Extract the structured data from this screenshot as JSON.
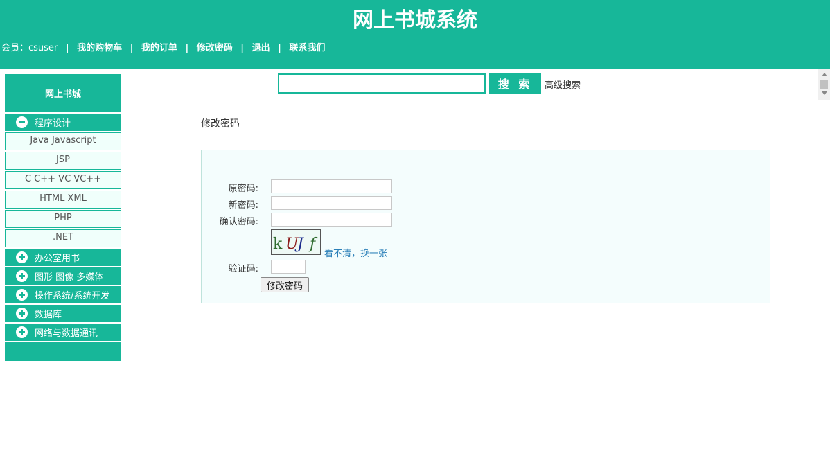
{
  "header": {
    "title": "网上书城系统",
    "member_label": "会员：csuser",
    "nav": [
      "我的购物车",
      "我的订单",
      "修改密码",
      "退出",
      "联系我们"
    ],
    "sep": "|"
  },
  "sidebar": {
    "title": "网上书城",
    "expanded_category": "程序设计",
    "subitems": [
      "Java Javascript",
      "JSP",
      "C C++ VC VC++",
      "HTML XML",
      "PHP",
      ".NET"
    ],
    "categories": [
      "办公室用书",
      "图形 图像 多媒体",
      "操作系统/系统开发",
      "数据库",
      "网络与数据通讯"
    ]
  },
  "search": {
    "placeholder": "",
    "button_label": "搜 索",
    "advanced_link": "高级搜索"
  },
  "main": {
    "page_title": "修改密码",
    "form": {
      "old_password_label": "原密码:",
      "new_password_label": "新密码:",
      "confirm_password_label": "确认密码:",
      "captcha_text": [
        "k",
        "U",
        "J",
        "f"
      ],
      "captcha_refresh": "看不清，换一张",
      "code_label": "验证码:",
      "submit_label": "修改密码"
    }
  },
  "colors": {
    "accent": "#17b799",
    "link": "#2a7fb8"
  }
}
